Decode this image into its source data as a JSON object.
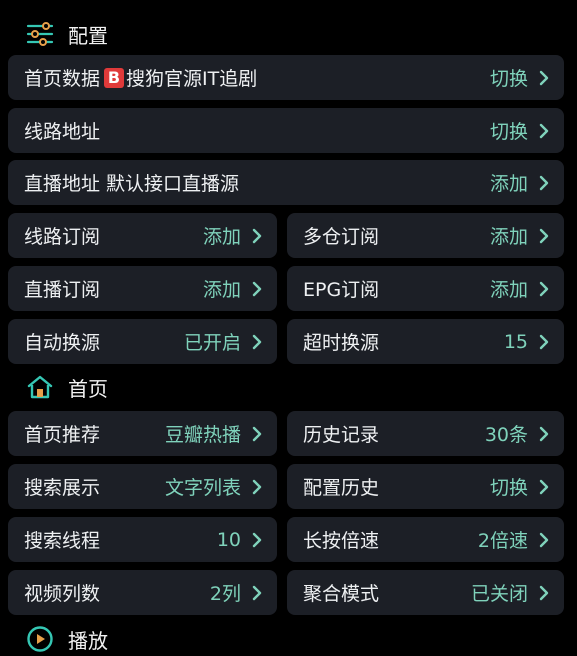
{
  "accent": "#7fd2bb",
  "config_section": {
    "title": "配置",
    "icon": "sliders-icon"
  },
  "home_section": {
    "title": "首页",
    "icon": "home-icon"
  },
  "play_section": {
    "title": "播放",
    "icon": "play-icon"
  },
  "rows": {
    "home_data": {
      "label_prefix": "首页数据",
      "badge": "B",
      "label_suffix": "搜狗官源IT追剧",
      "value": "切换"
    },
    "route_address": {
      "label": "线路地址",
      "value": "切换"
    },
    "live_address": {
      "label": "直播地址 默认接口直播源",
      "value": "添加"
    },
    "route_subscribe": {
      "label": "线路订阅",
      "value": "添加"
    },
    "multi_repo_subscribe": {
      "label": "多仓订阅",
      "value": "添加"
    },
    "live_subscribe": {
      "label": "直播订阅",
      "value": "添加"
    },
    "epg_subscribe": {
      "label": "EPG订阅",
      "value": "添加"
    },
    "auto_switch_source": {
      "label": "自动换源",
      "value": "已开启"
    },
    "timeout_switch_source": {
      "label": "超时换源",
      "value": "15"
    },
    "home_recommend": {
      "label": "首页推荐",
      "value": "豆瓣热播"
    },
    "history": {
      "label": "历史记录",
      "value": "30条"
    },
    "search_display": {
      "label": "搜索展示",
      "value": "文字列表"
    },
    "config_history": {
      "label": "配置历史",
      "value": "切换"
    },
    "search_threads": {
      "label": "搜索线程",
      "value": "10"
    },
    "long_press_speed": {
      "label": "长按倍速",
      "value": "2倍速"
    },
    "video_columns": {
      "label": "视频列数",
      "value": "2列"
    },
    "aggregate_mode": {
      "label": "聚合模式",
      "value": "已关闭"
    }
  }
}
